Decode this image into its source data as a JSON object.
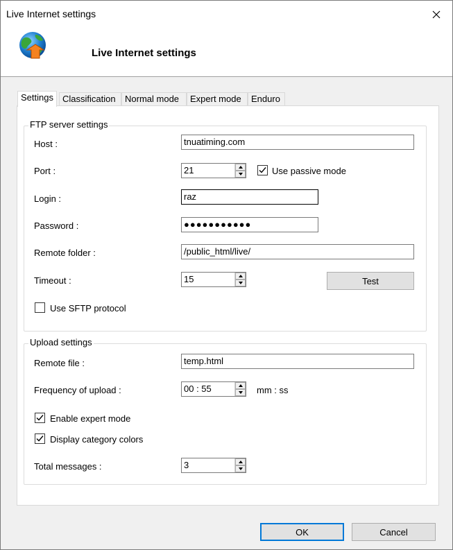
{
  "window": {
    "title": "Live Internet settings",
    "close_glyph": "✕"
  },
  "header": {
    "title": "Live Internet settings",
    "icon": "globe-upload-icon"
  },
  "tabs": [
    {
      "label": "Settings",
      "active": true
    },
    {
      "label": "Classification",
      "active": false
    },
    {
      "label": "Normal mode",
      "active": false
    },
    {
      "label": "Expert mode",
      "active": false
    },
    {
      "label": "Enduro",
      "active": false
    }
  ],
  "ftp": {
    "group_title": "FTP server settings",
    "host_label": "Host :",
    "host_value": "tnuatiming.com",
    "port_label": "Port :",
    "port_value": "21",
    "passive_label": "Use passive mode",
    "passive_checked": true,
    "login_label": "Login :",
    "login_value": "raz",
    "password_label": "Password :",
    "password_value": "●●●●●●●●●●●",
    "folder_label": "Remote folder :",
    "folder_value": "/public_html/live/",
    "timeout_label": "Timeout :",
    "timeout_value": "15",
    "test_label": "Test",
    "sftp_label": "Use SFTP protocol",
    "sftp_checked": false
  },
  "upload": {
    "group_title": "Upload settings",
    "remote_file_label": "Remote file :",
    "remote_file_value": "temp.html",
    "frequency_label": "Frequency of upload :",
    "frequency_value": "00 : 55",
    "frequency_unit": "mm : ss",
    "expert_label": "Enable expert mode",
    "expert_checked": true,
    "colors_label": "Display category colors",
    "colors_checked": true,
    "total_label": "Total messages :",
    "total_value": "3"
  },
  "buttons": {
    "ok": "OK",
    "cancel": "Cancel"
  },
  "colors": {
    "accent": "#0078d7",
    "panel": "#ffffff",
    "chrome": "#f0f0f0"
  }
}
